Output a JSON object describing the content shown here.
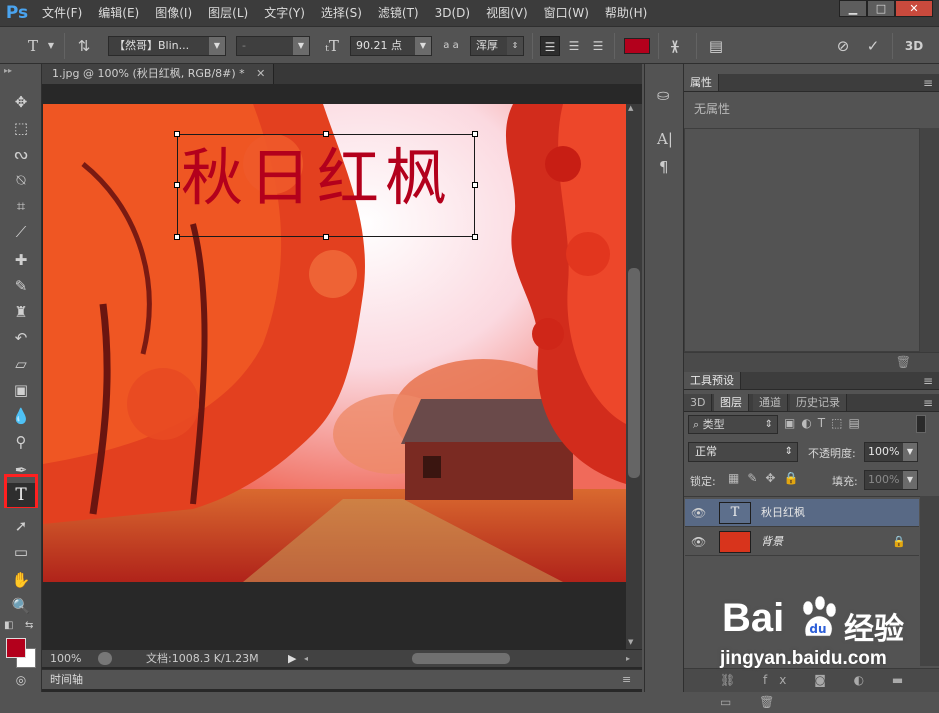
{
  "app": {
    "logo": "Ps"
  },
  "menu": [
    "文件(F)",
    "编辑(E)",
    "图像(I)",
    "图层(L)",
    "文字(Y)",
    "选择(S)",
    "滤镜(T)",
    "3D(D)",
    "视图(V)",
    "窗口(W)",
    "帮助(H)"
  ],
  "window_controls": {
    "minimize": "▁",
    "maximize": "□",
    "close": "✕"
  },
  "options": {
    "font_family": "【然哥】Blin...",
    "font_style": "-",
    "font_size": "90.21 点",
    "aa_label": "a a",
    "antialias": "浑厚",
    "text_color": "#b3001c"
  },
  "document": {
    "tab_title": "1.jpg @ 100% (秋日红枫, RGB/8#) *",
    "canvas_text": "秋日红枫",
    "zoom": "100%",
    "doc_size": "文档:1008.3 K/1.23M",
    "timeline": "时间轴"
  },
  "properties": {
    "tab": "属性",
    "empty": "无属性"
  },
  "tool_presets": {
    "tab": "工具预设"
  },
  "layers_panel": {
    "tabs": [
      "3D",
      "图层",
      "通道",
      "历史记录"
    ],
    "filter_kind": "类型",
    "blend_mode": "正常",
    "opacity_label": "不透明度:",
    "opacity": "100%",
    "lock_label": "锁定:",
    "fill_label": "填充:",
    "fill": "100%",
    "layers": [
      {
        "name": "秋日红枫",
        "type_badge": "T"
      },
      {
        "name": "背景"
      }
    ]
  },
  "watermark": {
    "brand": "Bai",
    "brand_cn": "经验",
    "url": "jingyan.baidu.com"
  },
  "colors": {
    "accent_red": "#b3001c",
    "selection_highlight": "#ff2020"
  }
}
